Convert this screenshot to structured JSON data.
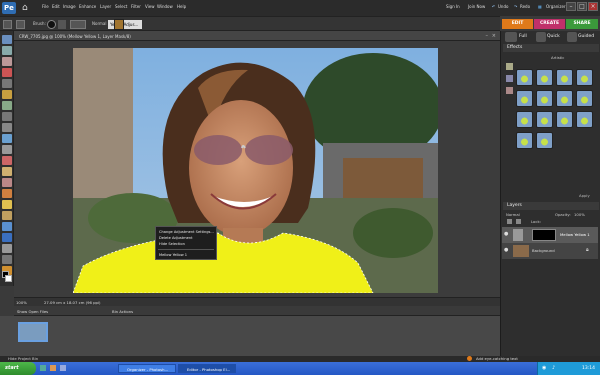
{
  "menubar": {
    "items": [
      "File",
      "Edit",
      "Image",
      "Enhance",
      "Layer",
      "Select",
      "Filter",
      "View",
      "Window",
      "Help"
    ],
    "right": [
      "Sign In",
      "Join Now",
      "Undo",
      "Redo",
      "Organizer"
    ]
  },
  "options": {
    "brush_label": "Brush:",
    "mode_label": "Normal",
    "layer_name": "Yellow Adjus..."
  },
  "mode_tabs": [
    {
      "label": "EDIT",
      "color": "#e07a1a"
    },
    {
      "label": "CREATE",
      "color": "#c0306a"
    },
    {
      "label": "SHARE",
      "color": "#3b9a3b"
    }
  ],
  "document": {
    "title": "CRW_7705.jpg @ 100% (Mellow Yellow 1, Layer Mask/8)",
    "zoom": "100%",
    "info": "27.09 cm x 18.07 cm (96 ppi)"
  },
  "context_menu": {
    "items": [
      "Change Adjustment Settings...",
      "Delete Adjustment",
      "Hide Selection",
      "Mellow Yellow 1"
    ]
  },
  "panels": {
    "edit_modes": [
      "Full",
      "Quick",
      "Guided"
    ],
    "effects_title": "Effects",
    "effects_filter": "Artistic",
    "effects_apply": "Apply",
    "layers_title": "Layers",
    "layers_blend": "Normal",
    "layers_opacity_label": "Opacity:",
    "layers_opacity": "100%",
    "layers_lock": "Lock:",
    "layers": [
      "Mellow Yellow 1",
      "Background"
    ]
  },
  "bin": {
    "dropdown": "Show Open Files",
    "actions": "Bin Actions",
    "hide_label": "Hide Project Bin",
    "tip": "Add eye-catching text"
  },
  "taskbar": {
    "start": "start",
    "buttons": [
      "Organizer - Photosh...",
      "Editor - Photoshop El..."
    ],
    "time": "13:14"
  }
}
